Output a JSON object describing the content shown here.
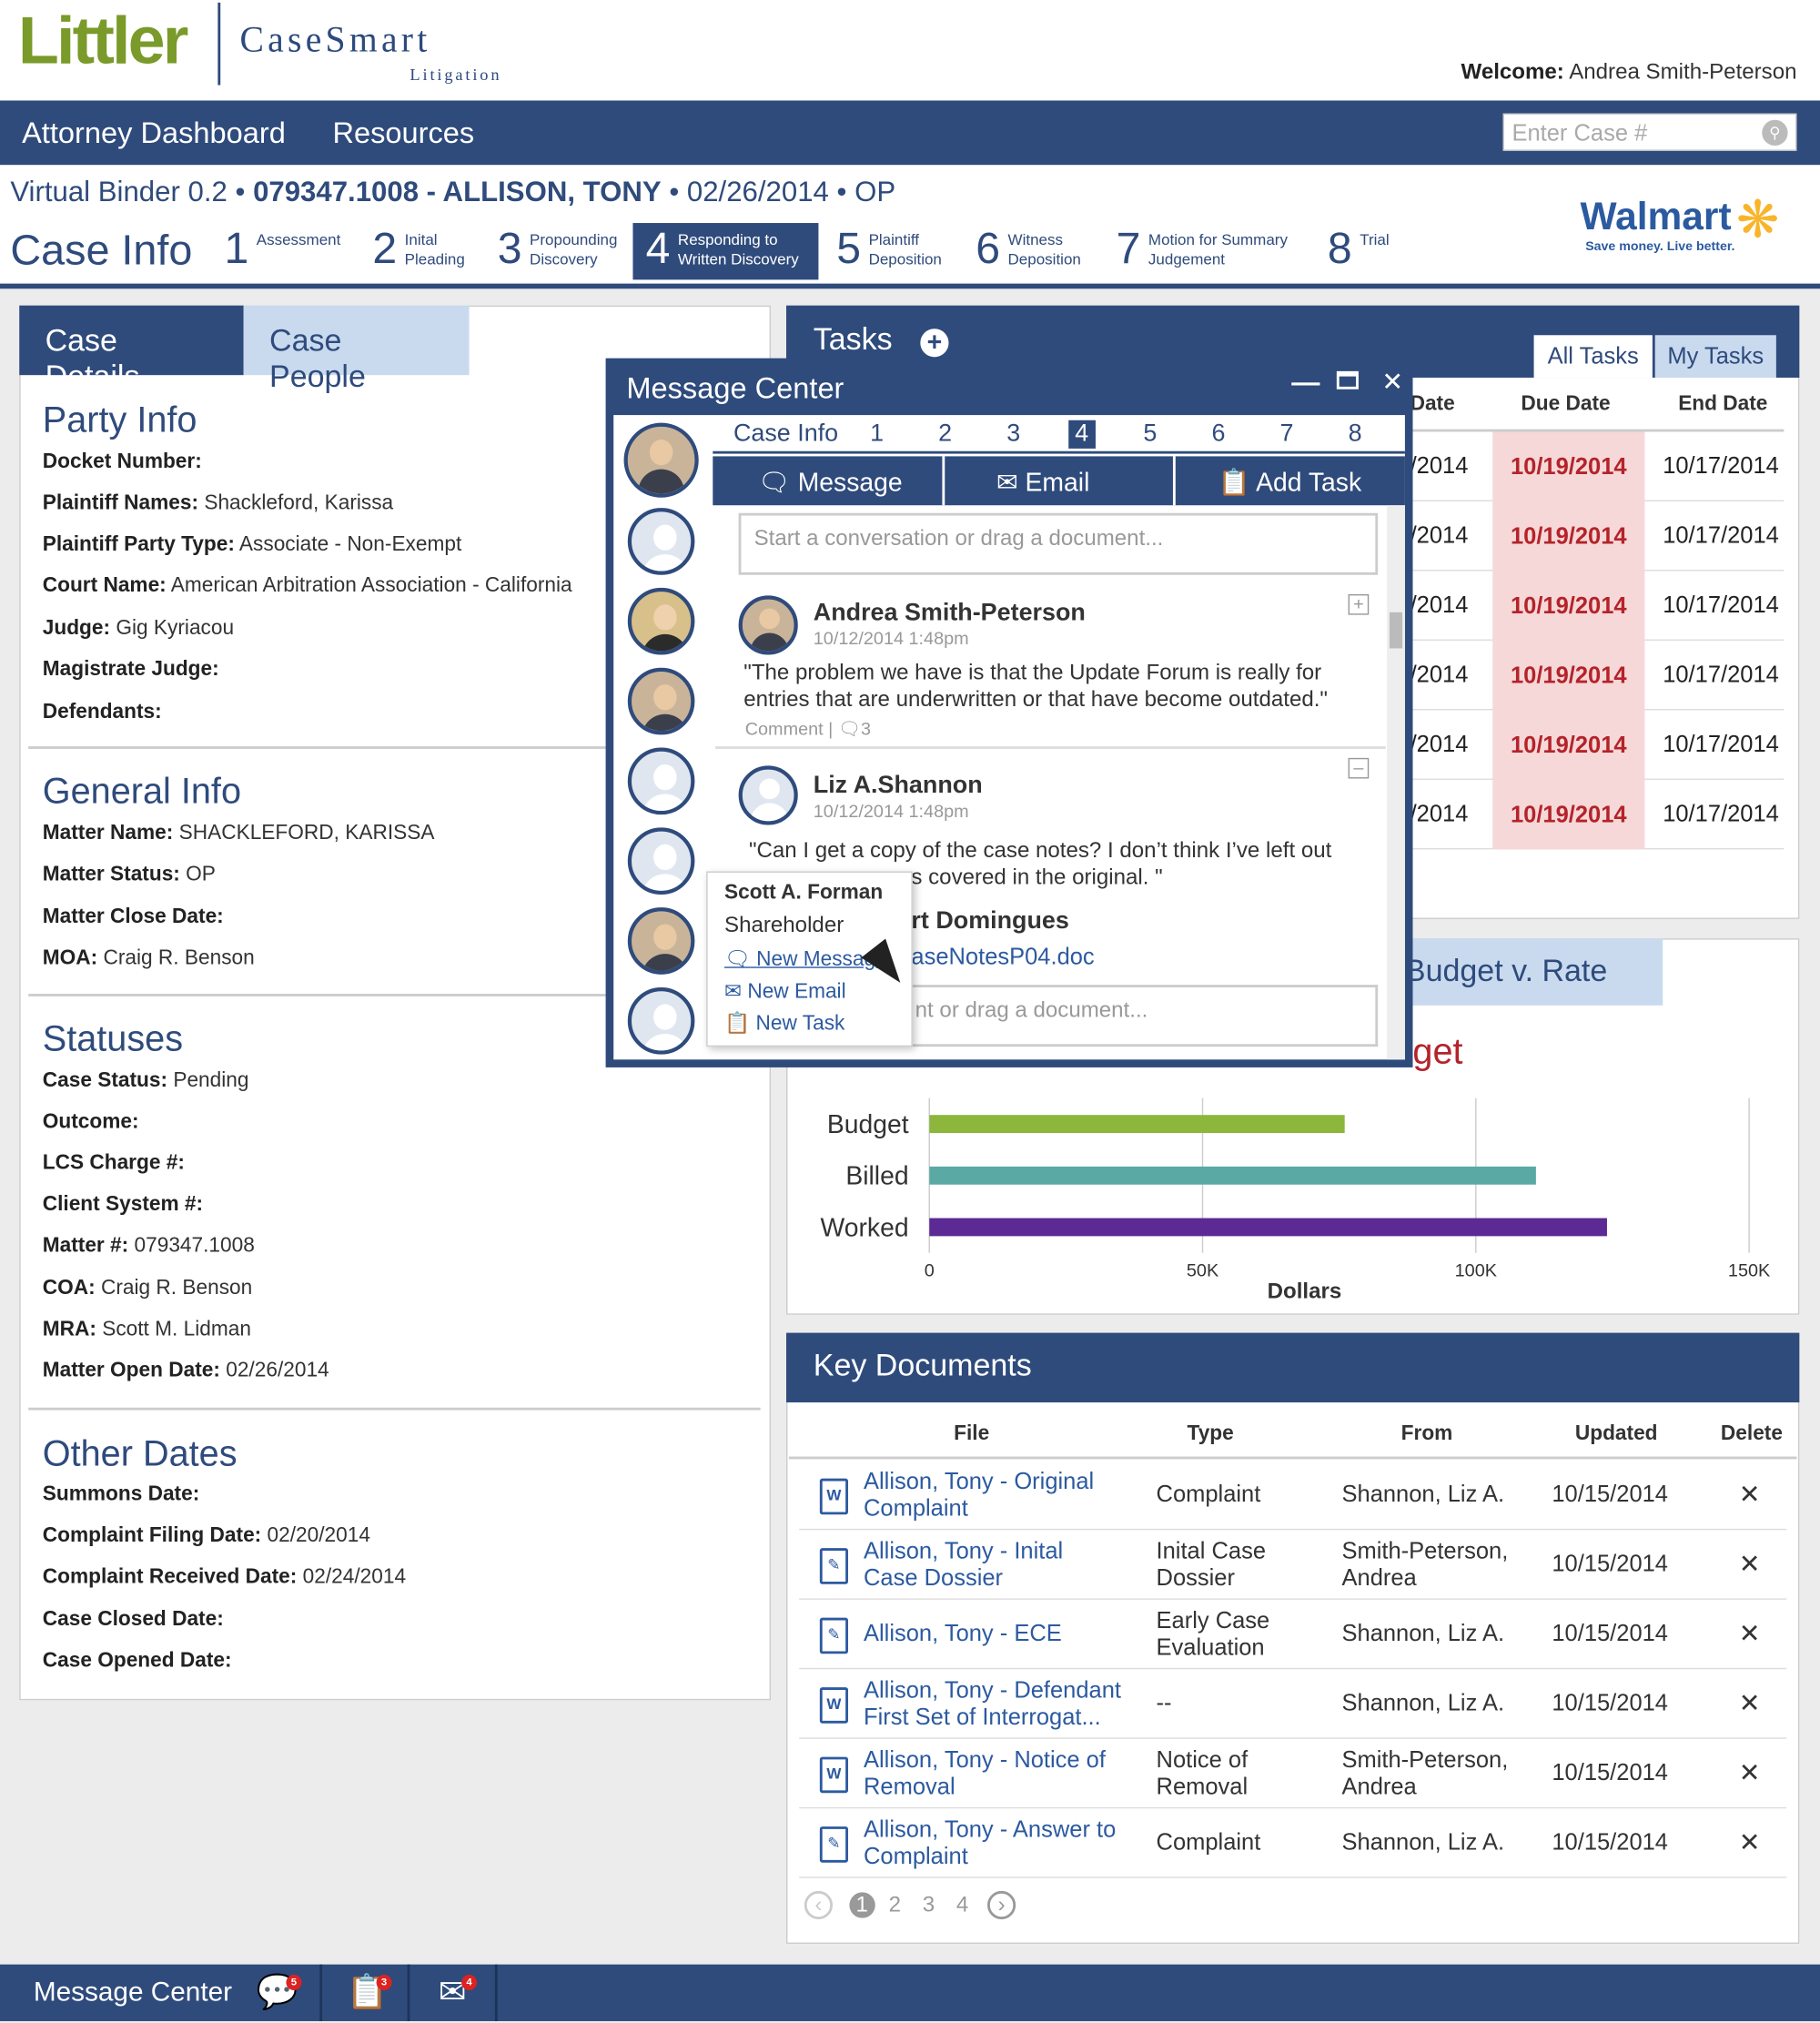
{
  "brand": {
    "logo": "Littler",
    "product": "CaseSmart",
    "product_sub": "Litigation"
  },
  "welcome": {
    "label": "Welcome:",
    "name": "Andrea Smith-Peterson"
  },
  "nav": {
    "items": [
      "Attorney Dashboard",
      "Resources"
    ],
    "search_placeholder": "Enter Case #"
  },
  "binder": {
    "prefix": "Virtual Binder 0.2 •",
    "case_id": "079347.1008 - ALLISON, TONY",
    "suffix": "• 02/26/2014 • OP"
  },
  "stages": {
    "case_info": "Case Info",
    "items": [
      {
        "num": "1",
        "label": "Assessment"
      },
      {
        "num": "2",
        "label": "Inital Pleading"
      },
      {
        "num": "3",
        "label": "Propounding Discovery"
      },
      {
        "num": "4",
        "label": "Responding to Written Discovery"
      },
      {
        "num": "5",
        "label": "Plaintiff Deposition"
      },
      {
        "num": "6",
        "label": "Witness Deposition"
      },
      {
        "num": "7",
        "label": "Motion for Summary Judgement"
      },
      {
        "num": "8",
        "label": "Trial"
      }
    ],
    "active_index": 3
  },
  "client": {
    "name": "Walmart",
    "tagline": "Save money. Live better."
  },
  "left_tabs": [
    "Case Details",
    "Case People"
  ],
  "party_info": {
    "title": "Party Info",
    "rows": [
      {
        "label": "Docket Number:",
        "value": ""
      },
      {
        "label": "Plaintiff Names:",
        "value": "Shackleford, Karissa"
      },
      {
        "label": "Plaintiff Party Type:",
        "value": "Associate - Non-Exempt"
      },
      {
        "label": "Court Name:",
        "value": "American Arbitration Association - California"
      },
      {
        "label": "Judge:",
        "value": "Gig Kyriacou"
      },
      {
        "label": "Magistrate Judge:",
        "value": ""
      },
      {
        "label": "Defendants:",
        "value": ""
      }
    ]
  },
  "general_info": {
    "title": "General Info",
    "rows": [
      {
        "label": "Matter Name:",
        "value": "SHACKLEFORD, KARISSA"
      },
      {
        "label": "Matter Status:",
        "value": "OP"
      },
      {
        "label": "Matter Close Date:",
        "value": ""
      },
      {
        "label": "MOA:",
        "value": "Craig R. Benson"
      }
    ]
  },
  "statuses": {
    "title": "Statuses",
    "rows": [
      {
        "label": "Case Status:",
        "value": "Pending"
      },
      {
        "label": "Outcome:",
        "value": ""
      },
      {
        "label": "LCS Charge #:",
        "value": ""
      },
      {
        "label": "Client System #:",
        "value": ""
      },
      {
        "label": "Matter #:",
        "value": "079347.1008"
      },
      {
        "label": "COA:",
        "value": "Craig R. Benson"
      },
      {
        "label": "MRA:",
        "value": "Scott M. Lidman"
      },
      {
        "label": "Matter Open Date:",
        "value": "02/26/2014"
      }
    ]
  },
  "other_dates": {
    "title": "Other Dates",
    "rows": [
      {
        "label": "Summons Date:",
        "value": ""
      },
      {
        "label": "Complaint Filing Date:",
        "value": "02/20/2014"
      },
      {
        "label": "Complaint Received Date:",
        "value": "02/24/2014"
      },
      {
        "label": "Case Closed Date:",
        "value": ""
      },
      {
        "label": "Case Opened Date:",
        "value": ""
      }
    ]
  },
  "tasks": {
    "title": "Tasks",
    "tabs": [
      "All Tasks",
      "My Tasks"
    ],
    "columns": [
      "Date",
      "Due Date",
      "End Date"
    ],
    "rows": [
      {
        "start": "/2014",
        "due": "10/19/2014",
        "end": "10/17/2014"
      },
      {
        "start": "/2014",
        "due": "10/19/2014",
        "end": "10/17/2014"
      },
      {
        "start": "/2014",
        "due": "10/19/2014",
        "end": "10/17/2014"
      },
      {
        "start": "/2014",
        "due": "10/19/2014",
        "end": "10/17/2014"
      },
      {
        "start": "/2014",
        "due": "10/19/2014",
        "end": "10/17/2014"
      },
      {
        "start": "/2014",
        "due": "10/19/2014",
        "end": "10/17/2014"
      }
    ]
  },
  "budget": {
    "tab": "Budget v. Rate",
    "heading_tail": "get",
    "axis": {
      "xlabel": "Dollars",
      "ticks": [
        "0",
        "50K",
        "100K",
        "150K"
      ]
    },
    "colors": {
      "Budget": "#8cb63c",
      "Billed": "#5aa9a4",
      "Worked": "#5b2a94"
    }
  },
  "chart_data": {
    "type": "bar",
    "categories": [
      "Budget",
      "Billed",
      "Worked"
    ],
    "values": [
      76000,
      111000,
      124000
    ],
    "title": "",
    "xlabel": "Dollars",
    "ylabel": "",
    "xlim": [
      0,
      150000
    ]
  },
  "key_documents": {
    "title": "Key Documents",
    "columns": [
      "File",
      "Type",
      "From",
      "Updated",
      "Delete"
    ],
    "rows": [
      {
        "file": "Allison, Tony - Original Complaint",
        "type": "Complaint",
        "from": "Shannon, Liz A.",
        "updated": "10/15/2014",
        "icon": "word-doc-icon"
      },
      {
        "file": "Allison, Tony - Inital Case Dossier",
        "type": "Inital Case Dossier",
        "from": "Smith-Peterson, Andrea",
        "updated": "10/15/2014",
        "icon": "pdf-doc-icon"
      },
      {
        "file": "Allison, Tony - ECE",
        "type": "Early Case Evaluation",
        "from": "Shannon, Liz A.",
        "updated": "10/15/2014",
        "icon": "pdf-doc-icon"
      },
      {
        "file": "Allison, Tony - Defendant First Set of Interrogat...",
        "type": "--",
        "from": "Shannon, Liz A.",
        "updated": "10/15/2014",
        "icon": "word-doc-icon"
      },
      {
        "file": "Allison, Tony - Notice of Removal",
        "type": "Notice of Removal",
        "from": "Smith-Peterson, Andrea",
        "updated": "10/15/2014",
        "icon": "word-doc-icon"
      },
      {
        "file": "Allison, Tony - Answer to Complaint",
        "type": "Complaint",
        "from": "Shannon, Liz A.",
        "updated": "10/15/2014",
        "icon": "pdf-doc-icon"
      }
    ],
    "pages": [
      "1",
      "2",
      "3",
      "4"
    ],
    "current_page": "1"
  },
  "message_center": {
    "title": "Message Center",
    "subtabs": [
      "Case Info",
      "1",
      "2",
      "3",
      "4",
      "5",
      "6",
      "7",
      "8"
    ],
    "active_subtab": "4",
    "actions": [
      "Message",
      "Email",
      "Add Task"
    ],
    "input_placeholder": "Start a conversation or drag a document...",
    "messages": [
      {
        "name": "Andrea Smith-Peterson",
        "time": "10/12/2014 1:48pm",
        "text": "\"The problem we have is that the Update Forum is really for entries that are underwritten or that have become outdated.\"",
        "comment": "Comment",
        "comment_count": "3"
      },
      {
        "name": "Liz A.Shannon",
        "time": "10/12/2014 1:48pm",
        "text_line1": "\"Can I get a copy of the case notes?  I don’t think I’ve left out",
        "text_line2": "s covered in the original. \"",
        "mention": "rt Domingues",
        "attachment": "aseNotesP04.doc",
        "reply_placeholder": "nt or drag a document..."
      }
    ],
    "tooltip": {
      "name": "Scott A. Forman",
      "role": "Shareholder",
      "actions": [
        "New Message",
        "New Email",
        "New Task"
      ]
    }
  },
  "footer": {
    "label": "Message Center",
    "counts": {
      "messages": "5",
      "tasks": "3",
      "emails": "4"
    }
  }
}
